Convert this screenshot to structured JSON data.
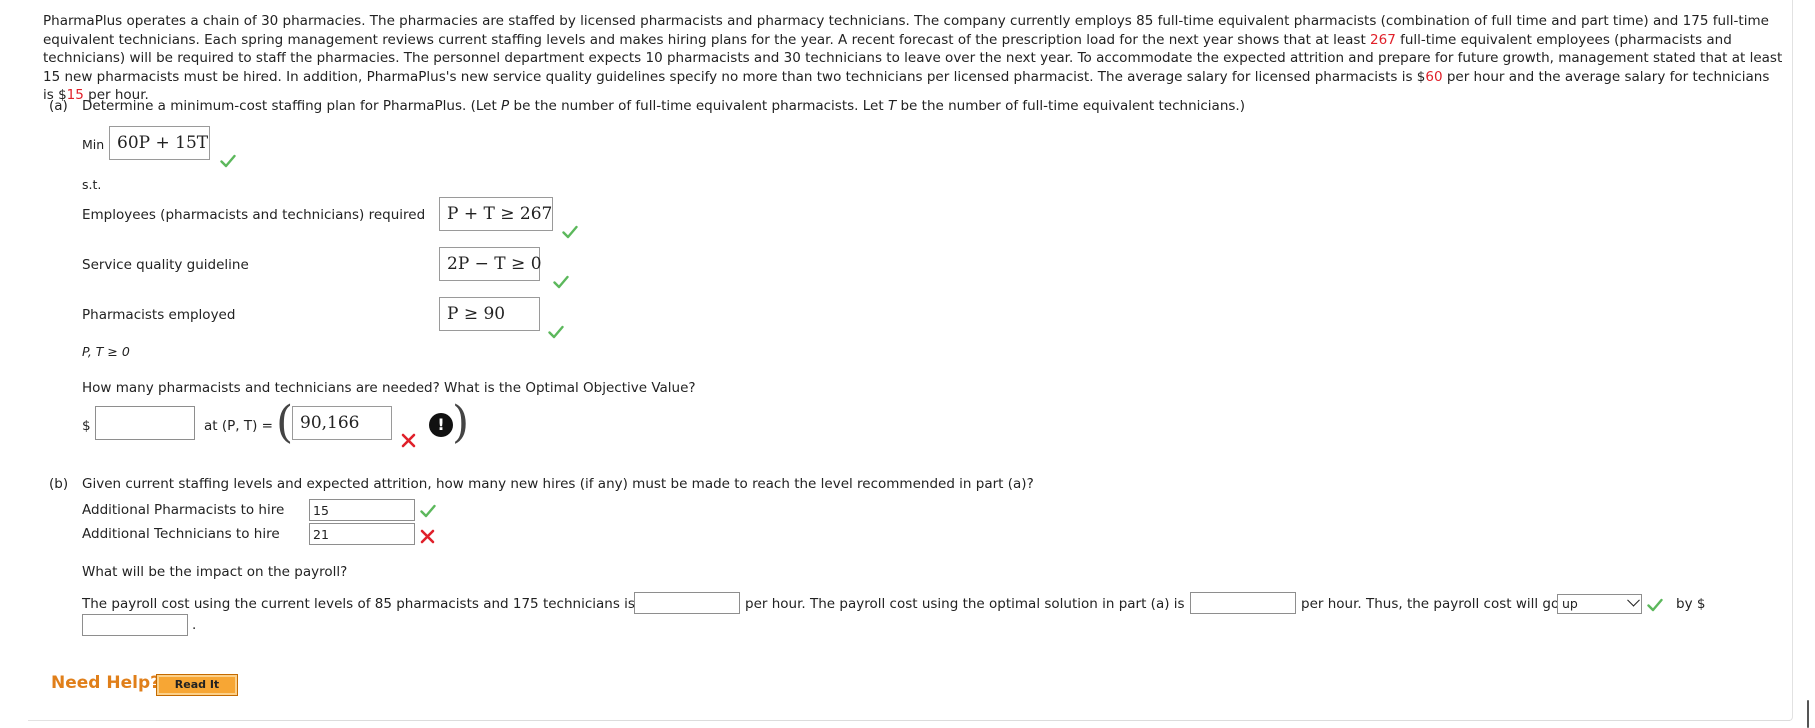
{
  "problem": {
    "part1": "PharmaPlus operates a chain of 30 pharmacies. The pharmacies are staffed by licensed pharmacists and pharmacy technicians. The company currently employs 85 full-time equivalent pharmacists (combination of full time and part time) and 175 full-time equivalent technicians. Each spring management reviews current staffing levels and makes hiring plans for the year. A recent forecast of the prescription load for the next year shows that at least ",
    "num_employees": "267",
    "part2": " full-time equivalent employees (pharmacists and technicians) will be required to staff the pharmacies. The personnel department expects 10 pharmacists and 30 technicians to leave over the next year. To accommodate the expected attrition and prepare for future growth, management stated that at least 15 new pharmacists must be hired. In addition, PharmaPlus's new service quality guidelines specify no more than two technicians per licensed pharmacist. The average salary for licensed pharmacists is $",
    "pharm_salary": "60",
    "part3": " per hour and the average salary for technicians is $",
    "tech_salary": "15",
    "part4": " per hour."
  },
  "part_a": {
    "label": "(a)",
    "prompt_start": "Determine a minimum-cost staffing plan for PharmaPlus. (Let ",
    "var_p": "P",
    "prompt_mid": " be the number of full-time equivalent pharmacists. Let ",
    "var_t": "T",
    "prompt_end": " be the number of full-time equivalent technicians.)",
    "min_label": "Min",
    "objective": "60P + 15T",
    "st_label": "s.t.",
    "constraints": [
      {
        "label": "Employees (pharmacists and technicians) required",
        "expr": "P + T ≥ 267"
      },
      {
        "label": "Service quality guideline",
        "expr": "2P − T ≥ 0"
      },
      {
        "label": "Pharmacists employed",
        "expr": "P ≥ 90"
      }
    ],
    "nonneg": "P, T ≥ 0",
    "question": "How many pharmacists and technicians are needed? What is the Optimal Objective Value?",
    "dollar": "$",
    "objective_value": "",
    "at_label": "at (P, T) =",
    "pt_value": "90,166"
  },
  "part_b": {
    "label": "(b)",
    "prompt": "Given current staffing levels and expected attrition, how many new hires (if any) must be made to reach the level recommended in part (a)?",
    "rows": [
      {
        "label": "Additional Pharmacists to hire",
        "value": "15",
        "status": "correct"
      },
      {
        "label": "Additional Technicians to hire",
        "value": "21",
        "status": "incorrect"
      }
    ],
    "payroll_question": "What will be the impact on the payroll?",
    "payroll_text1": "The payroll cost using the current levels of 85 pharmacists and 175 technicians is $",
    "payroll_current": "",
    "payroll_text2": "per hour. The payroll cost using the optimal solution in part (a) is $",
    "payroll_optimal": "",
    "payroll_text3": "per hour. Thus, the payroll cost will go",
    "direction_selected": "up",
    "payroll_text4": "by $",
    "payroll_diff": "",
    "period": "."
  },
  "help": {
    "label": "Need Help?",
    "button": "Read It"
  },
  "colors": {
    "correct": "#5cb85c",
    "incorrect": "#e0202a",
    "highlight": "#e0202a",
    "help_orange": "#e07f1a"
  }
}
